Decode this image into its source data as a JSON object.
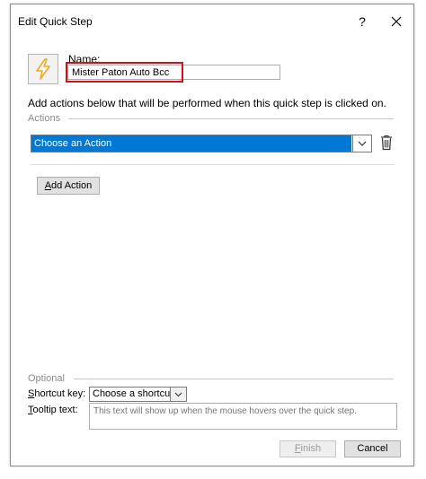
{
  "window": {
    "title": "Edit Quick Step",
    "help_label": "?",
    "close_icon": "close-icon"
  },
  "quickstep_icon": "lightning-bolt-icon",
  "name": {
    "label": "Name:",
    "value": "Mister Paton Auto Bcc"
  },
  "instructions": "Add actions below that will be performed when this quick step is clicked on.",
  "actions": {
    "section_label": "Actions",
    "action_select": {
      "selected": "Choose an Action"
    },
    "delete_icon": "trash-icon",
    "add_action_button": {
      "accel": "A",
      "rest": "dd Action"
    }
  },
  "optional": {
    "section_label": "Optional",
    "shortcut": {
      "label_accel": "S",
      "label_rest": "hortcut key:",
      "selected": "Choose a shortcut"
    },
    "tooltip": {
      "label_accel": "T",
      "label_rest": "ooltip text:",
      "placeholder": "This text will show up when the mouse hovers over the quick step."
    }
  },
  "footer": {
    "finish_accel": "F",
    "finish_rest": "inish",
    "cancel_label": "Cancel"
  },
  "colors": {
    "selection_blue": "#0078d7",
    "highlight_red": "#d10f1b",
    "bolt_orange": "#f5a623"
  }
}
